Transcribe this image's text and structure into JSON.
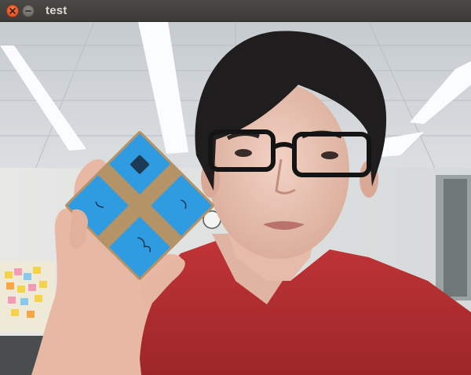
{
  "window": {
    "title": "test",
    "close_icon": "close-icon",
    "minimize_icon": "minimize-icon"
  },
  "colors": {
    "titlebar": "#3c3b37",
    "close_button": "#e95420",
    "title_text": "#dfdbd2",
    "card_blue": "#2f9be0",
    "card_tan": "#b49466",
    "shirt": "#b22c2f"
  }
}
